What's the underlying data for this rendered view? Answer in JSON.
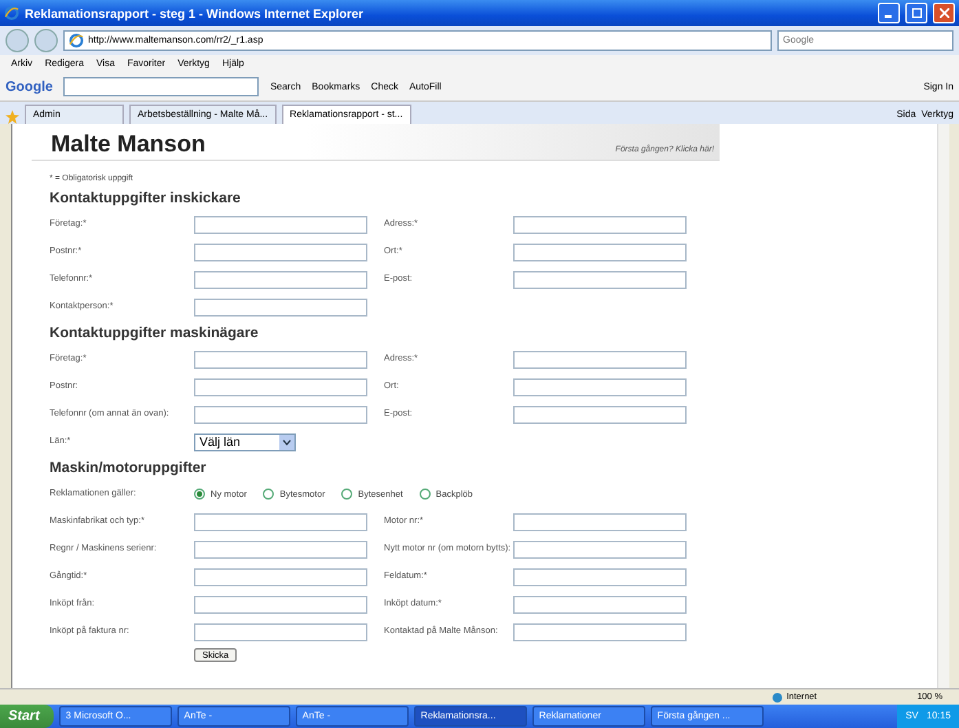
{
  "window": {
    "title": "Reklamationsrapport - steg 1 - Windows Internet Explorer"
  },
  "address_bar": {
    "url": "http://www.maltemanson.com/rr2/_r1.asp",
    "search_placeholder": "Google"
  },
  "menu": [
    "Arkiv",
    "Redigera",
    "Visa",
    "Favoriter",
    "Verktyg",
    "Hjälp"
  ],
  "google_toolbar": {
    "logo": "Google",
    "buttons": [
      "Search",
      "Bookmarks",
      "Check",
      "AutoFill"
    ],
    "sign_in": "Sign In"
  },
  "tabs": [
    {
      "label": "Admin",
      "selected": false
    },
    {
      "label": "Arbetsbeställning - Malte Må...",
      "selected": false
    },
    {
      "label": "Reklamationsrapport - st...",
      "selected": true
    }
  ],
  "command_bar": [
    "Sida",
    "Verktyg"
  ],
  "page": {
    "brand": "Malte Manson",
    "first_time_link": "Första gången? Klicka här!",
    "required_note": "* = Obligatorisk uppgift",
    "sections": [
      {
        "title": "Kontaktuppgifter inskickare",
        "rows": [
          {
            "kind": "pair",
            "fields": [
              {
                "label": "Företag:*"
              },
              {
                "label": "Adress:*"
              }
            ]
          },
          {
            "kind": "pair",
            "fields": [
              {
                "label": "Postnr:*"
              },
              {
                "label": "Ort:*"
              }
            ]
          },
          {
            "kind": "pair",
            "fields": [
              {
                "label": "Telefonnr:*"
              },
              {
                "label": "E-post:"
              }
            ]
          },
          {
            "kind": "pair",
            "fields": [
              {
                "label": "Kontaktperson:*"
              }
            ]
          }
        ]
      },
      {
        "title": "Kontaktuppgifter maskinägare",
        "rows": [
          {
            "kind": "pair",
            "fields": [
              {
                "label": "Företag:*"
              },
              {
                "label": "Adress:*"
              }
            ]
          },
          {
            "kind": "pair",
            "fields": [
              {
                "label": "Postnr:"
              },
              {
                "label": "Ort:"
              }
            ]
          },
          {
            "kind": "pair",
            "fields": [
              {
                "label": "Telefonnr (om annat än ovan):"
              },
              {
                "label": "E-post:"
              }
            ]
          },
          {
            "kind": "select",
            "label": "Län:*",
            "value": "Välj län"
          }
        ]
      },
      {
        "title": "Maskin/motoruppgifter",
        "rows": [
          {
            "kind": "radio",
            "label": "Reklamationen gäller:",
            "options": [
              {
                "label": "Ny motor",
                "selected": true
              },
              {
                "label": "Bytesmotor",
                "selected": false
              },
              {
                "label": "Bytesenhet",
                "selected": false
              },
              {
                "label": "Backplöb",
                "selected": false
              }
            ]
          },
          {
            "kind": "pair",
            "fields": [
              {
                "label": "Maskinfabrikat och typ:*"
              },
              {
                "label": "Motor nr:*"
              }
            ]
          },
          {
            "kind": "pair",
            "fields": [
              {
                "label": "Regnr / Maskinens serienr:"
              },
              {
                "label": "Nytt motor nr (om motorn bytts):"
              }
            ]
          },
          {
            "kind": "pair",
            "fields": [
              {
                "label": "Gångtid:*"
              },
              {
                "label": "Feldatum:*"
              }
            ]
          },
          {
            "kind": "pair",
            "fields": [
              {
                "label": "Inköpt från:"
              },
              {
                "label": "Inköpt datum:*"
              }
            ]
          },
          {
            "kind": "pair",
            "fields": [
              {
                "label": "Inköpt på faktura nr:"
              },
              {
                "label": "Kontaktad på Malte Månson:"
              }
            ]
          }
        ]
      }
    ],
    "submit": "Skicka"
  },
  "status_bar": {
    "zone": "Internet",
    "zoom": "100 %"
  },
  "taskbar": {
    "start": "Start",
    "items": [
      {
        "label": "3 Microsoft O...",
        "selected": false
      },
      {
        "label": "AnTe -",
        "selected": false
      },
      {
        "label": "AnTe -",
        "selected": false
      },
      {
        "label": "Reklamationsra...",
        "selected": true
      },
      {
        "label": "Reklamationer",
        "selected": false
      },
      {
        "label": "Första gången ...",
        "selected": false
      }
    ],
    "language": "SV",
    "clock": "10:15"
  }
}
